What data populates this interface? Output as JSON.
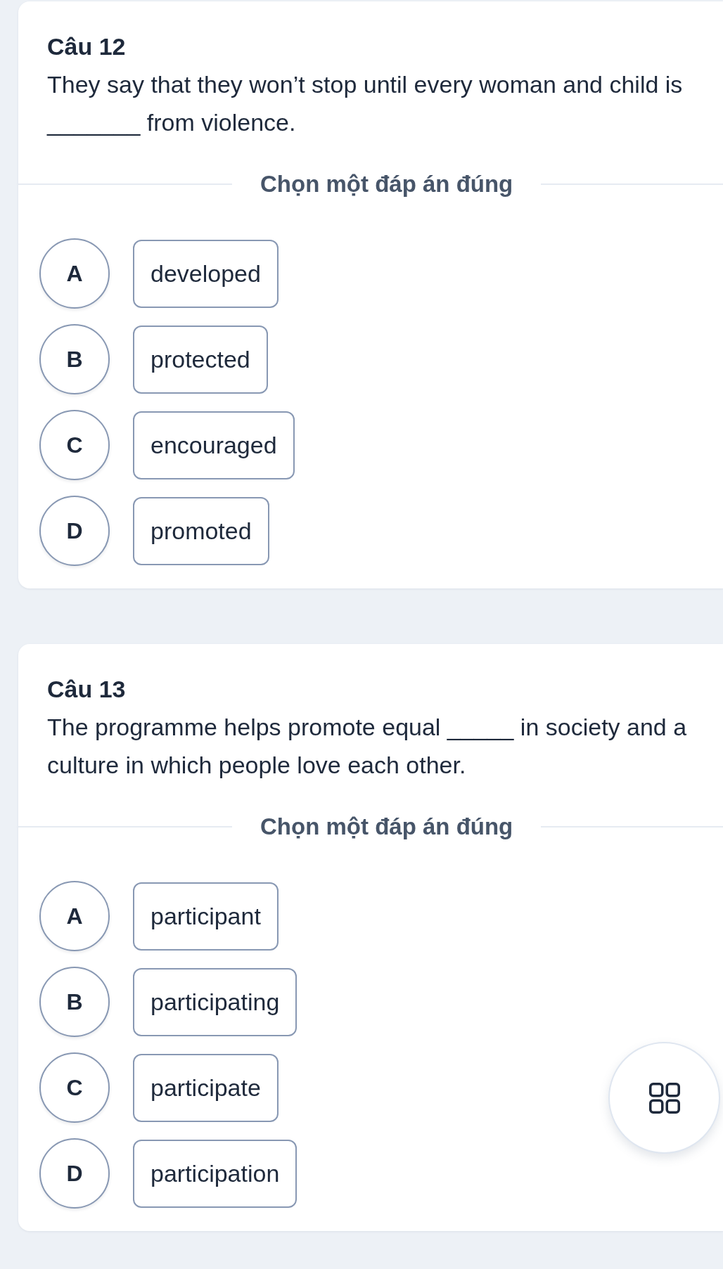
{
  "questions": [
    {
      "title": "Câu 12",
      "text": "They say that they won’t stop until every woman and child is _______ from violence.",
      "instruction": "Chọn một đáp án đúng",
      "options": [
        {
          "letter": "A",
          "text": "developed",
          "selected": false
        },
        {
          "letter": "B",
          "text": "protected",
          "selected": false
        },
        {
          "letter": "C",
          "text": "encouraged",
          "selected": false
        },
        {
          "letter": "D",
          "text": "promoted",
          "selected": false
        }
      ]
    },
    {
      "title": "Câu 13",
      "text": "The programme helps promote equal _____ in society and a culture in which people love each other.",
      "instruction": "Chọn một đáp án đúng",
      "options": [
        {
          "letter": "A",
          "text": "participant",
          "selected": false
        },
        {
          "letter": "B",
          "text": "participating",
          "selected": false
        },
        {
          "letter": "C",
          "text": "participate",
          "selected": false
        },
        {
          "letter": "D",
          "text": "participation",
          "selected": false
        }
      ]
    }
  ]
}
